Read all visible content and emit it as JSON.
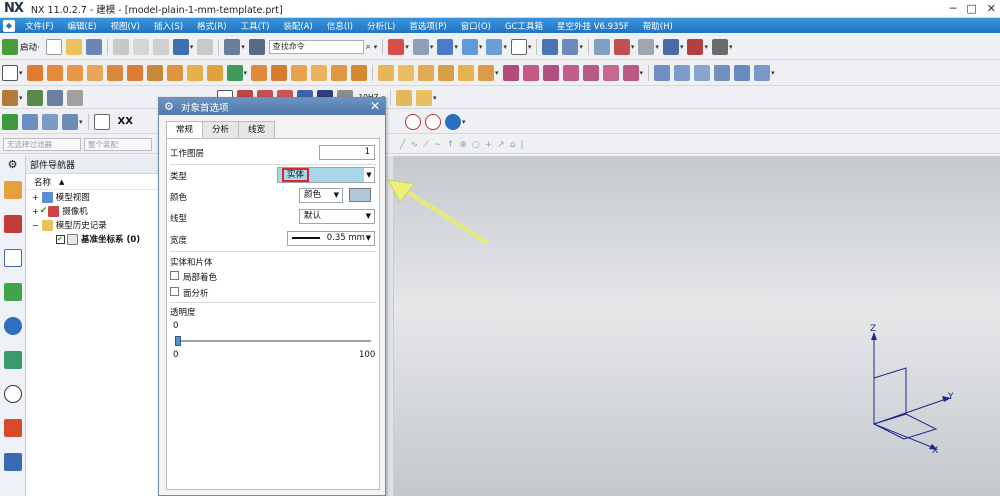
{
  "window": {
    "logo": "NX",
    "title": "NX 11.0.2.7 - 建模 - [model-plain-1-mm-template.prt]",
    "min_glyph": "─",
    "max_glyph": "□",
    "close_glyph": "✕"
  },
  "menubar": {
    "items": [
      "文件(F)",
      "编辑(E)",
      "视图(V)",
      "插入(S)",
      "格式(R)",
      "工具(T)",
      "装配(A)",
      "信息(I)",
      "分析(L)",
      "首选项(P)",
      "窗口(O)",
      "GC工具箱",
      "星空外挂 V6.935F",
      "帮助(H)"
    ]
  },
  "toolbar1": {
    "start_label": "启动·",
    "search_placeholder": "查找命令"
  },
  "toolbar3": {
    "fit_label": "10H7"
  },
  "toolbar4": {
    "xx_label": "XX"
  },
  "filters": {
    "type_filter": "无选择过滤器",
    "scope_filter": "整个装配"
  },
  "navigator": {
    "title": "部件导航器",
    "column_name": "名称",
    "sort_glyph": "▲",
    "rows": [
      {
        "label": "模型视图",
        "indent": 0
      },
      {
        "label": "摄像机",
        "indent": 0
      },
      {
        "label": "模型历史记录",
        "indent": 0
      },
      {
        "label": "基准坐标系 (0)",
        "indent": 1
      }
    ]
  },
  "dialog": {
    "title": "对象首选项",
    "tabs": [
      "常规",
      "分析",
      "线宽"
    ],
    "work_layer_label": "工作图层",
    "work_layer_value": "1",
    "type_label": "类型",
    "type_value": "实体",
    "color_label": "颜色",
    "color_value": "颜色",
    "line_type_label": "线型",
    "line_type_value": "默认",
    "width_label": "宽度",
    "width_value": "0.35 mm",
    "solid_section_label": "实体和片体",
    "partial_shading_label": "局部着色",
    "face_analysis_label": "面分析",
    "transparency_label": "透明度",
    "transparency_value": "0",
    "slider_min": "0",
    "slider_max": "100",
    "slider_fraction": 0.0
  },
  "csys": {
    "z_label": "Z",
    "y_label": "Y",
    "x_label": "X"
  },
  "colors": {
    "menubar": "#2b7fd0",
    "dialog_title": "#5d86b8",
    "highlight_box": "#e0262a",
    "type_field_fill": "#a9d7ea",
    "arrow": "#e9ef7a",
    "color_swatch": "#b3c6d6"
  }
}
